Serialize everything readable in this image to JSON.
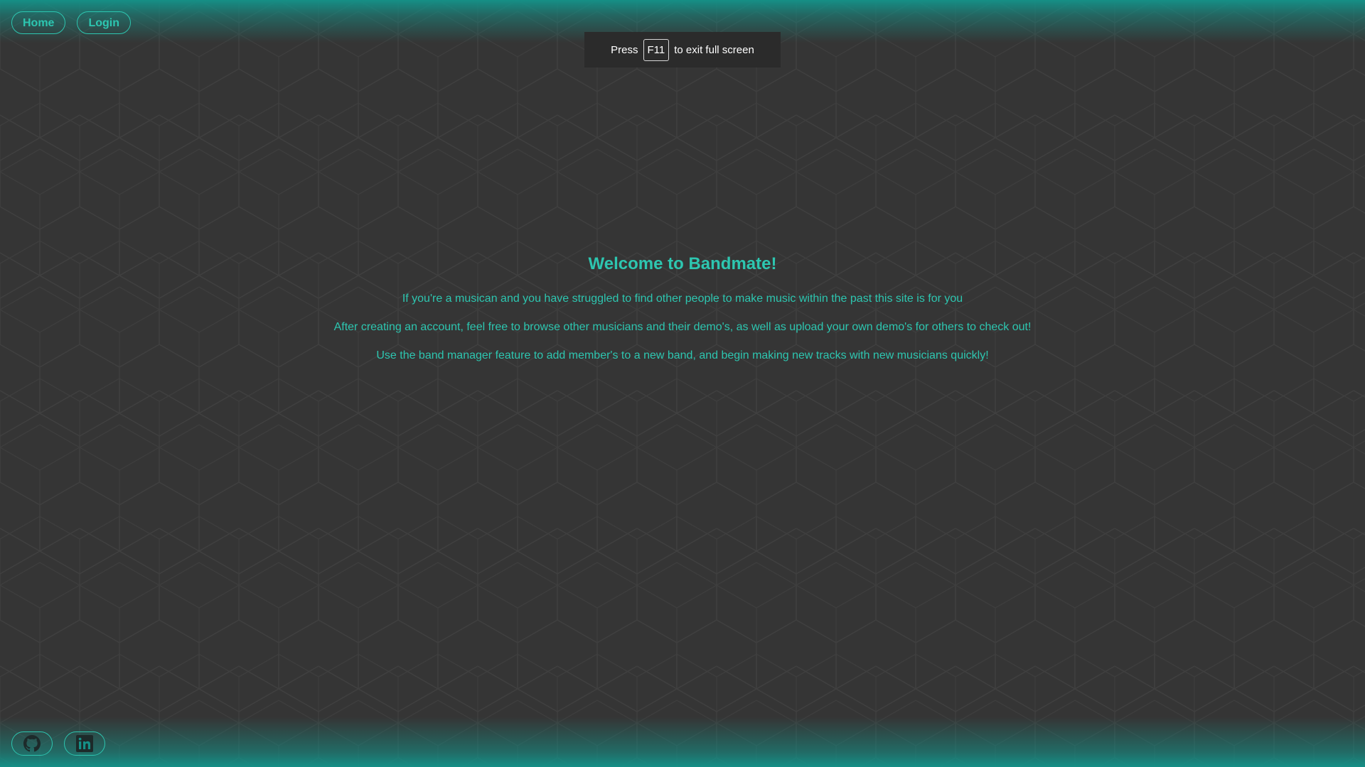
{
  "nav": {
    "home_label": "Home",
    "login_label": "Login"
  },
  "fullscreen_notice": {
    "press": "Press",
    "key": "F11",
    "suffix": "to exit full screen"
  },
  "main": {
    "title": "Welcome to Bandmate!",
    "paragraphs": [
      "If you're a musican and you have struggled to find other people to make music within the past this site is for you",
      "After creating an account, feel free to browse other musicians and their demo's, as well as upload your own demo's for others to check out!",
      "Use the band manager feature to add member's to a new band, and begin making new tracks with new musicians quickly!"
    ]
  },
  "footer": {
    "icons": [
      "github-icon",
      "linkedin-icon"
    ]
  },
  "colors": {
    "background": "#353535",
    "accent": "#2dc6b0",
    "glow": "#158f86",
    "icon_dark": "#1d2a2a"
  }
}
